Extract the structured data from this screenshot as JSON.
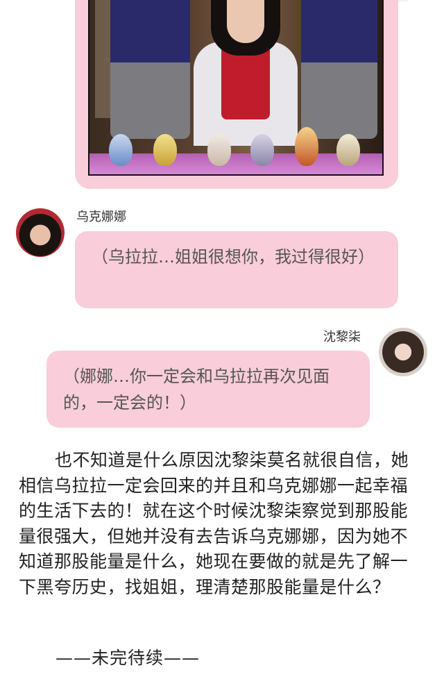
{
  "image_post": {
    "description_image": "drama still with jeweled eggs"
  },
  "messages": [
    {
      "sender": "乌克娜娜",
      "side": "left",
      "text": "（乌拉拉…姐姐很想你，我过得很好）"
    },
    {
      "sender": "沈黎柒",
      "side": "right",
      "text": "（娜娜…你一定会和乌拉拉再次见面的，一定会的！）"
    }
  ],
  "narrative": "也不知道是什么原因沈黎柒莫名就很自信，她相信乌拉拉一定会回来的并且和乌克娜娜一起幸福的生活下去的！就在这个时候沈黎柒察觉到那股能量很强大，但她并没有去告诉乌克娜娜，因为她不知道那股能量是什么，她现在要做的就是先了解一下黑夸历史，找姐姐，理清楚那股能量是什么？",
  "to_be_continued": "——未完待续——",
  "colors": {
    "bubble": "#f9cdd9",
    "background": "#ffffff",
    "text": "#222222"
  }
}
